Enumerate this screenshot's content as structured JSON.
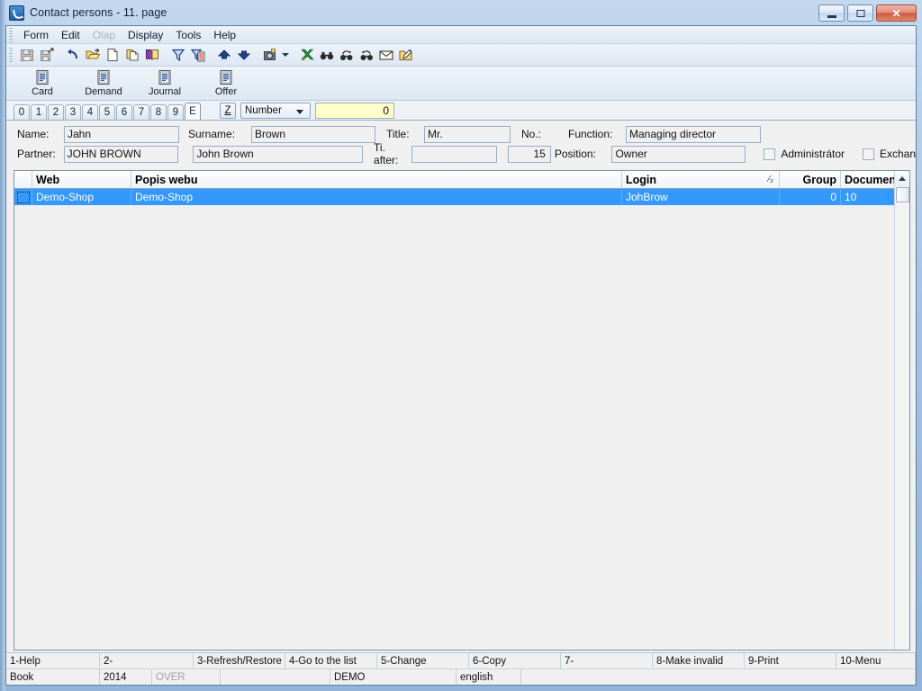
{
  "window": {
    "title": "Contact persons - 11. page",
    "app_icon": "app-logo-icon",
    "controls": {
      "minimize": "minimize-button",
      "maximize": "maximize-button",
      "close_glyph": "✕"
    }
  },
  "menu": {
    "items": [
      {
        "label": "Form",
        "disabled": false
      },
      {
        "label": "Edit",
        "disabled": false
      },
      {
        "label": "Olap",
        "disabled": true
      },
      {
        "label": "Display",
        "disabled": false
      },
      {
        "label": "Tools",
        "disabled": false
      },
      {
        "label": "Help",
        "disabled": false
      }
    ]
  },
  "toolbar": {
    "buttons": [
      {
        "name": "save-icon",
        "disabled": true
      },
      {
        "name": "save-as-icon",
        "disabled": true
      },
      {
        "name": "undo-icon",
        "disabled": false
      },
      {
        "name": "open-folder-icon",
        "disabled": false
      },
      {
        "name": "new-document-icon",
        "disabled": false
      },
      {
        "name": "copy-icon",
        "disabled": false
      },
      {
        "name": "book-icon",
        "disabled": false
      },
      {
        "name": "filter-icon",
        "disabled": false
      },
      {
        "name": "filter-report-icon",
        "disabled": false
      },
      {
        "name": "arrow-up-icon",
        "disabled": false
      },
      {
        "name": "arrow-down-icon",
        "disabled": false
      },
      {
        "name": "camera-icon",
        "disabled": false
      },
      {
        "name": "export-icon",
        "disabled": false
      },
      {
        "name": "find-icon",
        "disabled": false
      },
      {
        "name": "find-next-icon",
        "disabled": false
      },
      {
        "name": "find-previous-icon",
        "disabled": false
      },
      {
        "name": "mail-icon",
        "disabled": false
      },
      {
        "name": "edit-folder-icon",
        "disabled": false
      }
    ]
  },
  "bigbar": {
    "buttons": [
      {
        "label": "Card",
        "icon": "document-icon"
      },
      {
        "label": "Demand",
        "icon": "document-icon"
      },
      {
        "label": "Journal",
        "icon": "document-icon"
      },
      {
        "label": "Offer",
        "icon": "document-icon"
      }
    ]
  },
  "tabs": {
    "items": [
      "0",
      "1",
      "2",
      "3",
      "4",
      "5",
      "6",
      "7",
      "8",
      "9",
      "E"
    ],
    "active": "E",
    "z_button": "Z",
    "mode_select": {
      "value": "Number",
      "options": [
        "Number"
      ]
    },
    "number_value": "0"
  },
  "form": {
    "name": {
      "label": "Name:",
      "value": "Jahn"
    },
    "surname": {
      "label": "Surname:",
      "value": "Brown"
    },
    "title": {
      "label": "Title:",
      "value": "Mr."
    },
    "no": {
      "label": "No.:",
      "value": ""
    },
    "function": {
      "label": "Function:",
      "value": "Managing director"
    },
    "partner": {
      "label": "Partner:",
      "value": "JOHN BROWN"
    },
    "partner_full": {
      "value": "John Brown"
    },
    "title_after": {
      "label": "Ti. after:",
      "value": ""
    },
    "no_value": {
      "value": "15"
    },
    "position": {
      "label": "Position:",
      "value": "Owner"
    },
    "administrator": {
      "label": "Administrátor",
      "checked": false
    },
    "exchange": {
      "label": "Exchan",
      "checked": false
    }
  },
  "grid": {
    "columns": [
      {
        "label": "Web",
        "align": "left"
      },
      {
        "label": "Popis webu",
        "align": "left"
      },
      {
        "label": "Login",
        "align": "left",
        "sort": "⁄₂"
      },
      {
        "label": "Group",
        "align": "right"
      },
      {
        "label": "Documen",
        "align": "left"
      }
    ],
    "rows": [
      {
        "selected": true,
        "cells": [
          "Demo-Shop",
          "Demo-Shop",
          "JohBrow",
          "0",
          "10"
        ]
      }
    ],
    "scroll_up_icon": "scroll-up-arrow-icon"
  },
  "fkeys": [
    "1-Help",
    "2-",
    "3-Refresh/Restore",
    "4-Go to the list",
    "5-Change",
    "6-Copy",
    "7-",
    "8-Make invalid",
    "9-Print",
    "10-Menu"
  ],
  "status": [
    {
      "text": "Book",
      "dim": false
    },
    {
      "text": "2014",
      "dim": false
    },
    {
      "text": "OVER",
      "dim": true
    },
    {
      "text": "",
      "dim": false
    },
    {
      "text": "DEMO",
      "dim": false
    },
    {
      "text": "english",
      "dim": false
    },
    {
      "text": "",
      "dim": false
    }
  ],
  "colors": {
    "selection": "#3399ff",
    "number_field": "#ffffcc",
    "window_frame": "#a8c4e2",
    "client_bg": "#f0f0f0"
  }
}
